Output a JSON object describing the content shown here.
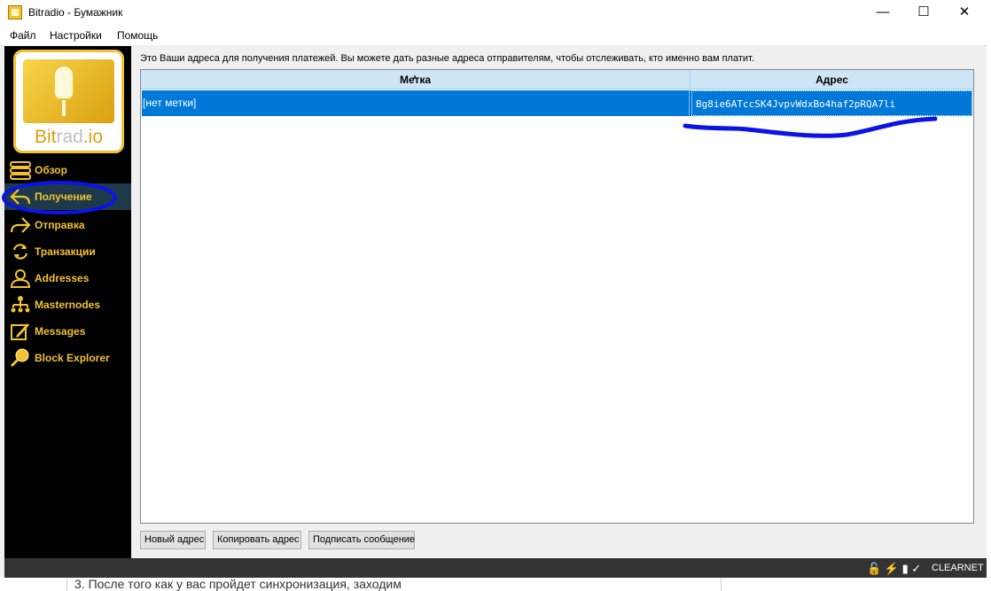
{
  "window": {
    "title": "Bitradio - Бумажник",
    "minimize": "—",
    "maximize": "☐",
    "close": "✕"
  },
  "menu": [
    "Файл",
    "Настройки",
    "Помощь"
  ],
  "logo": {
    "brand_a": "Bit",
    "brand_b": "rad",
    "brand_c": ".io"
  },
  "sidebar": {
    "items": [
      {
        "label": "Обзор",
        "icon": "overview-icon"
      },
      {
        "label": "Получение",
        "icon": "receive-icon",
        "active": true
      },
      {
        "label": "Отправка",
        "icon": "send-icon"
      },
      {
        "label": "Транзакции",
        "icon": "transactions-icon"
      },
      {
        "label": "Addresses",
        "icon": "addresses-icon"
      },
      {
        "label": "Masternodes",
        "icon": "masternodes-icon"
      },
      {
        "label": "Messages",
        "icon": "messages-icon"
      },
      {
        "label": "Block Explorer",
        "icon": "block-explorer-icon"
      }
    ]
  },
  "main": {
    "info": "Это Ваши адреса для получения платежей. Вы можете дать разные адреса отправителям, чтобы отслеживать, кто именно вам платит.",
    "table": {
      "columns": [
        "Метка",
        "Адрес"
      ],
      "rows": [
        {
          "label": "[нет метки]",
          "address": "Bg8ie6ATccSK4JvpvWdxBo4haf2pRQA7li"
        }
      ]
    },
    "buttons": {
      "new_address": "Новый адрес",
      "copy_address": "Копировать адрес",
      "sign_message": "Подписать сообщение"
    }
  },
  "status": {
    "network": "CLEARNET",
    "icons": "🔓⚡▮✓"
  },
  "behind_page": {
    "text": "3. После того как у вас пройдет синхронизация, заходим"
  },
  "colors": {
    "accent": "#f2c230",
    "selection": "#0078d7",
    "annotation": "#0a14e6"
  }
}
